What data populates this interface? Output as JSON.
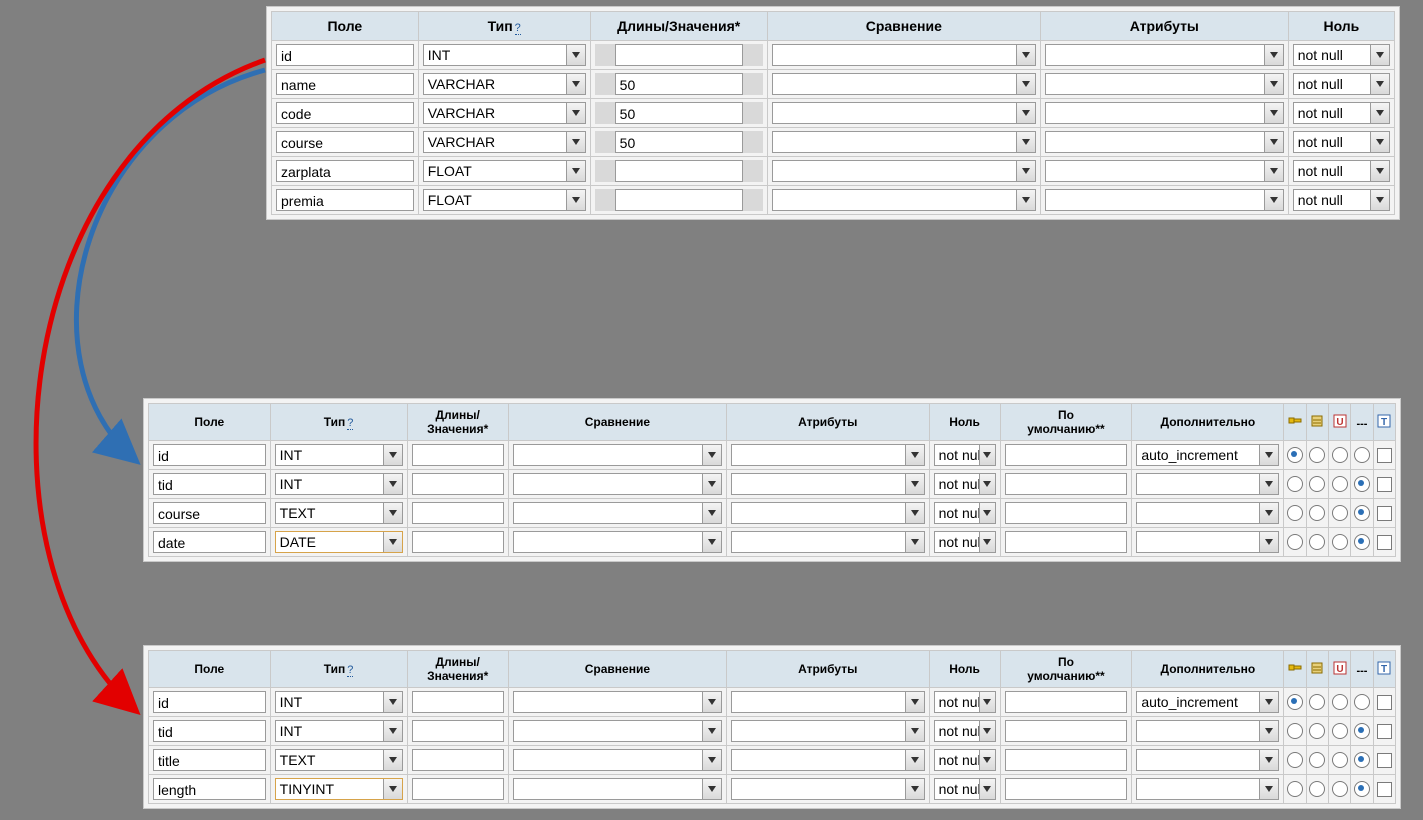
{
  "table1": {
    "headers": {
      "field": "Поле",
      "type": "Тип",
      "type_help": "?",
      "length": "Длины/Значения*",
      "collation": "Сравнение",
      "attributes": "Атрибуты",
      "null": "Ноль"
    },
    "rows": [
      {
        "field": "id",
        "type": "INT",
        "length": "",
        "collation": "",
        "attributes": "",
        "null": "not null"
      },
      {
        "field": "name",
        "type": "VARCHAR",
        "length": "50",
        "collation": "",
        "attributes": "",
        "null": "not null"
      },
      {
        "field": "code",
        "type": "VARCHAR",
        "length": "50",
        "collation": "",
        "attributes": "",
        "null": "not null"
      },
      {
        "field": "course",
        "type": "VARCHAR",
        "length": "50",
        "collation": "",
        "attributes": "",
        "null": "not null"
      },
      {
        "field": "zarplata",
        "type": "FLOAT",
        "length": "",
        "collation": "",
        "attributes": "",
        "null": "not null"
      },
      {
        "field": "premia",
        "type": "FLOAT",
        "length": "",
        "collation": "",
        "attributes": "",
        "null": "not null"
      }
    ]
  },
  "table2": {
    "headers": {
      "field": "Поле",
      "type": "Тип",
      "type_help": "?",
      "length": "Длины/\nЗначения*",
      "collation": "Сравнение",
      "attributes": "Атрибуты",
      "null": "Ноль",
      "default": "По\nумолчанию**",
      "extra": "Дополнительно"
    },
    "rows": [
      {
        "field": "id",
        "type": "INT",
        "length": "",
        "collation": "",
        "attributes": "",
        "null": "not null",
        "default": "",
        "extra": "auto_increment",
        "radio_sel": 0
      },
      {
        "field": "tid",
        "type": "INT",
        "length": "",
        "collation": "",
        "attributes": "",
        "null": "not null",
        "default": "",
        "extra": "",
        "radio_sel": 3
      },
      {
        "field": "course",
        "type": "TEXT",
        "length": "",
        "collation": "",
        "attributes": "",
        "null": "not null",
        "default": "",
        "extra": "",
        "radio_sel": 3
      },
      {
        "field": "date",
        "type": "DATE",
        "length": "",
        "collation": "",
        "attributes": "",
        "null": "not null",
        "default": "",
        "extra": "",
        "radio_sel": 3,
        "highlight": true
      }
    ]
  },
  "table3": {
    "headers": {
      "field": "Поле",
      "type": "Тип",
      "type_help": "?",
      "length": "Длины/\nЗначения*",
      "collation": "Сравнение",
      "attributes": "Атрибуты",
      "null": "Ноль",
      "default": "По\nумолчанию**",
      "extra": "Дополнительно"
    },
    "rows": [
      {
        "field": "id",
        "type": "INT",
        "length": "",
        "collation": "",
        "attributes": "",
        "null": "not null",
        "default": "",
        "extra": "auto_increment",
        "radio_sel": 0
      },
      {
        "field": "tid",
        "type": "INT",
        "length": "",
        "collation": "",
        "attributes": "",
        "null": "not null",
        "default": "",
        "extra": "",
        "radio_sel": 3
      },
      {
        "field": "title",
        "type": "TEXT",
        "length": "",
        "collation": "",
        "attributes": "",
        "null": "not null",
        "default": "",
        "extra": "",
        "radio_sel": 3
      },
      {
        "field": "length",
        "type": "TINYINT",
        "length": "",
        "collation": "",
        "attributes": "",
        "null": "not null",
        "default": "",
        "extra": "",
        "radio_sel": 3,
        "highlight": true
      }
    ]
  },
  "icon_labels": {
    "primary": "primary-key",
    "index": "index",
    "unique": "unique",
    "dashes": "---",
    "fulltext": "fulltext"
  }
}
